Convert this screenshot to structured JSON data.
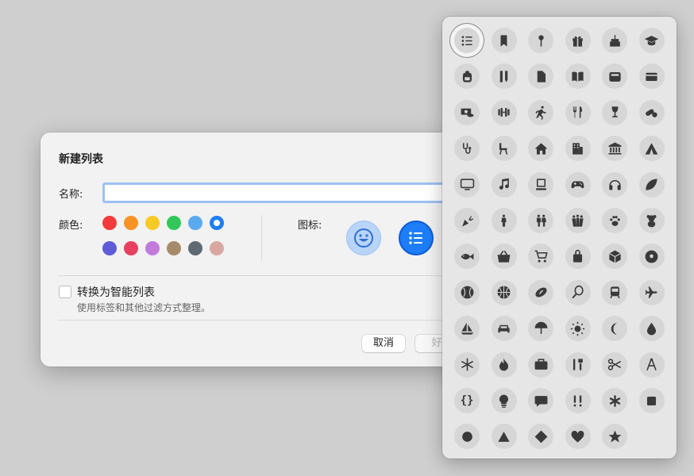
{
  "dialog": {
    "title": "新建列表",
    "name_label": "名称:",
    "name_value": "",
    "color_label": "颜色:",
    "icon_label": "图标:",
    "colors": [
      "#f23b3b",
      "#f79325",
      "#f7c923",
      "#33c759",
      "#5aaaf0",
      "#1d7ef7",
      "#5e5cd6",
      "#e8415f",
      "#c27bdb",
      "#a68b6b",
      "#5f6a72",
      "#d9a7a2"
    ],
    "smart_list": {
      "title": "转换为智能列表",
      "subtitle": "使用标签和其他过滤方式整理。"
    },
    "cancel_label": "取消",
    "ok_label": "好"
  },
  "icon_picker": {
    "selected_index": 0,
    "icons": [
      "list-icon",
      "bookmark-icon",
      "pin-icon",
      "gift-icon",
      "cake-icon",
      "graduation-cap-icon",
      "backpack-icon",
      "ruler-pencil-icon",
      "document-icon",
      "book-icon",
      "wallet-icon",
      "credit-card-icon",
      "money-icon",
      "dumbbell-icon",
      "running-icon",
      "fork-knife-icon",
      "wine-glass-icon",
      "pills-icon",
      "stethoscope-icon",
      "chair-icon",
      "house-icon",
      "building-icon",
      "museum-icon",
      "tent-icon",
      "tv-icon",
      "music-note-icon",
      "computer-icon",
      "gamecontroller-icon",
      "headphones-icon",
      "leaf-icon",
      "carrot-icon",
      "person-icon",
      "two-people-icon",
      "three-people-icon",
      "pawprint-icon",
      "teddy-bear-icon",
      "fish-icon",
      "basket-icon",
      "cart-icon",
      "bag-icon",
      "box-icon",
      "soccer-ball-icon",
      "baseball-icon",
      "basketball-icon",
      "football-icon",
      "tennis-racket-icon",
      "tram-icon",
      "airplane-icon",
      "sailboat-icon",
      "car-icon",
      "beach-umbrella-icon",
      "sun-icon",
      "moon-icon",
      "drop-icon",
      "snowflake-icon",
      "flame-icon",
      "briefcase-icon",
      "tools-icon",
      "scissors-icon",
      "compass-icon",
      "braces-icon",
      "lightbulb-icon",
      "speech-bubble-icon",
      "exclamation-icon",
      "asterisk-icon",
      "square-icon",
      "circle-icon",
      "triangle-icon",
      "diamond-icon",
      "heart-icon",
      "star-icon"
    ]
  }
}
